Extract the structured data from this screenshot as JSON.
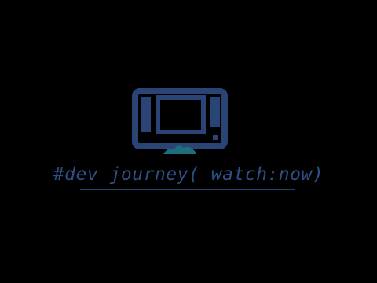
{
  "brand": {
    "tagline": "#dev journey( watch:now)",
    "icon": "monitor-icon",
    "colors": {
      "background": "#000000",
      "monitor_frame": "#2a4476",
      "monitor_accent": "#1f6e7c",
      "text": "#2f4f86"
    }
  }
}
